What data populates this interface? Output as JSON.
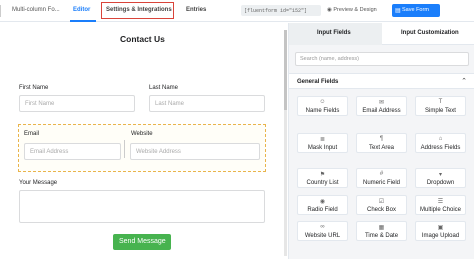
{
  "topbar": {
    "form_title": "Multi-column Fo...",
    "tabs": [
      {
        "label": "Editor"
      },
      {
        "label": "Settings & Integrations"
      },
      {
        "label": "Entries"
      }
    ],
    "shortcode": "[fluentform id=\"152\"]",
    "preview_label": "Preview & Design",
    "save_label": "Save Form",
    "accent": "#1a7efb",
    "highlight": "#d9443a"
  },
  "form": {
    "title": "Contact Us",
    "first_name": {
      "label": "First Name",
      "placeholder": "First Name"
    },
    "last_name": {
      "label": "Last Name",
      "placeholder": "Last Name"
    },
    "email": {
      "label": "Email",
      "placeholder": "Email Address"
    },
    "website": {
      "label": "Website",
      "placeholder": "Website Address"
    },
    "message": {
      "label": "Your Message"
    },
    "submit_label": "Send Message",
    "submit_color": "#47b34f"
  },
  "sidebar": {
    "tabs": [
      {
        "label": "Input Fields"
      },
      {
        "label": "Input Customization"
      }
    ],
    "search_placeholder": "Search (name, address)",
    "section_label": "General Fields",
    "fields": [
      {
        "label": "Name Fields",
        "icon": "user-icon",
        "glyph": "☺"
      },
      {
        "label": "Email Address",
        "icon": "mail-icon",
        "glyph": "✉"
      },
      {
        "label": "Simple Text",
        "icon": "text-icon",
        "glyph": "T"
      },
      {
        "label": "Mask Input",
        "icon": "mask-icon",
        "glyph": "≣"
      },
      {
        "label": "Text Area",
        "icon": "paragraph-icon",
        "glyph": "¶"
      },
      {
        "label": "Address Fields",
        "icon": "address-icon",
        "glyph": "⌂"
      },
      {
        "label": "Country List",
        "icon": "flag-icon",
        "glyph": "⚑"
      },
      {
        "label": "Numeric Field",
        "icon": "hash-icon",
        "glyph": "#"
      },
      {
        "label": "Dropdown",
        "icon": "dropdown-icon",
        "glyph": "▾"
      },
      {
        "label": "Radio Field",
        "icon": "radio-icon",
        "glyph": "◉"
      },
      {
        "label": "Check Box",
        "icon": "checkbox-icon",
        "glyph": "☑"
      },
      {
        "label": "Multiple Choice",
        "icon": "list-icon",
        "glyph": "☰"
      },
      {
        "label": "Website URL",
        "icon": "link-icon",
        "glyph": "∞"
      },
      {
        "label": "Time & Date",
        "icon": "calendar-icon",
        "glyph": "▦"
      },
      {
        "label": "Image Upload",
        "icon": "image-icon",
        "glyph": "▣"
      }
    ]
  }
}
